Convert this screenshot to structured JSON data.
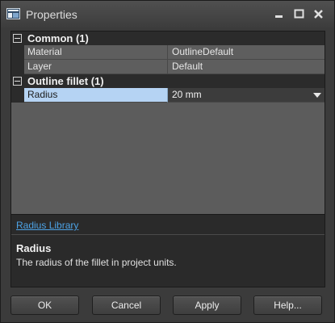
{
  "window": {
    "title": "Properties",
    "icon": "properties-window-icon"
  },
  "titlebar_buttons": {
    "minimize_icon": "minimize-icon",
    "maximize_icon": "maximize-icon",
    "close_icon": "close-icon"
  },
  "grid": {
    "categories": [
      {
        "label": "Common (1)",
        "expanded": true,
        "properties": [
          {
            "name": "Material",
            "value": "OutlineDefault"
          },
          {
            "name": "Layer",
            "value": "Default"
          }
        ]
      },
      {
        "label": "Outline fillet (1)",
        "expanded": true,
        "properties": [
          {
            "name": "Radius",
            "value": "20 mm",
            "selected": true
          }
        ]
      }
    ]
  },
  "link": {
    "label": "Radius Library"
  },
  "help": {
    "title": "Radius",
    "description": "The radius of the fillet in project units."
  },
  "buttons": {
    "ok": "OK",
    "cancel": "Cancel",
    "apply": "Apply",
    "help": "Help..."
  },
  "colors": {
    "selection": "#b5d3f3",
    "link": "#4da3e6",
    "background": "#3b3b3b"
  }
}
